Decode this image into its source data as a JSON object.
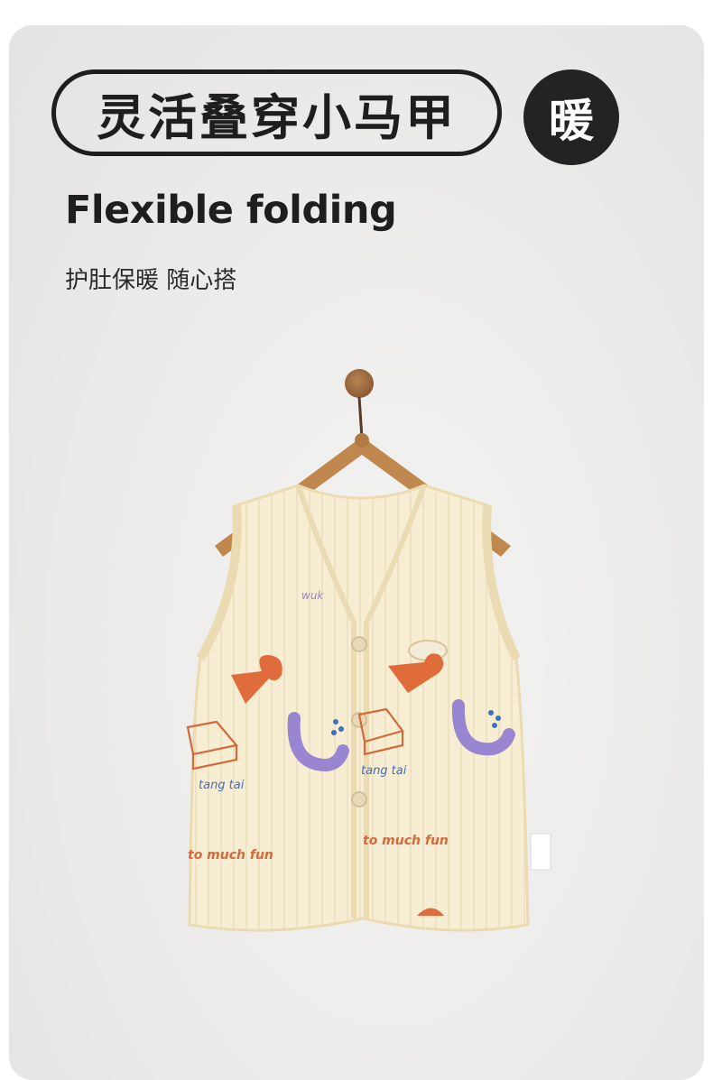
{
  "heading": {
    "pill_text": "灵活叠穿小马甲",
    "badge_text": "暖"
  },
  "title": "Flexible folding",
  "subtitle": "护肚保暖 随心搭",
  "product_photo": {
    "subject": "children's quilted vest on wooden hanger",
    "print_text": [
      "tang tai",
      "tang tai",
      "to much fun",
      "to much fun",
      "wuk"
    ]
  }
}
